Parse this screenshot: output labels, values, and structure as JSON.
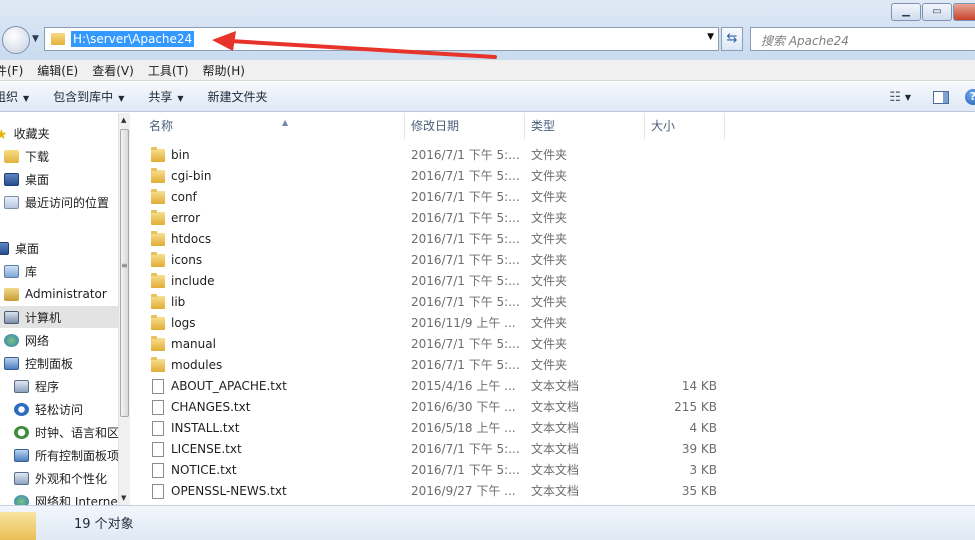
{
  "address": {
    "path": "H:\\server\\Apache24"
  },
  "search": {
    "placeholder": "搜索 Apache24"
  },
  "window_controls": {
    "minimize": "▁",
    "maximize": "▭",
    "close": ""
  },
  "menu": [
    "件(F)",
    "编辑(E)",
    "查看(V)",
    "工具(T)",
    "帮助(H)"
  ],
  "toolbar": {
    "organize": "组织",
    "include_in_library": "包含到库中",
    "share": "共享",
    "new_folder": "新建文件夹"
  },
  "nav": [
    {
      "label": "收藏夹",
      "icon": "star-icon"
    },
    {
      "label": "下载",
      "icon": "download-folder-icon"
    },
    {
      "label": "桌面",
      "icon": "desktop-icon"
    },
    {
      "label": "最近访问的位置",
      "icon": "recent-places-icon"
    },
    {
      "label": "桌面",
      "icon": "desktop-icon"
    },
    {
      "label": "库",
      "icon": "library-icon"
    },
    {
      "label": "Administrator",
      "icon": "user-folder-icon"
    },
    {
      "label": "计算机",
      "icon": "computer-icon",
      "selected": true
    },
    {
      "label": "网络",
      "icon": "network-icon"
    },
    {
      "label": "控制面板",
      "icon": "control-panel-icon"
    },
    {
      "label": "程序",
      "icon": "programs-icon"
    },
    {
      "label": "轻松访问",
      "icon": "ease-of-access-icon"
    },
    {
      "label": "时钟、语言和区",
      "icon": "clock-icon"
    },
    {
      "label": "所有控制面板项",
      "icon": "all-control-panel-icon"
    },
    {
      "label": "外观和个性化",
      "icon": "appearance-icon"
    },
    {
      "label": "网络和 Interne",
      "icon": "network-internet-icon"
    }
  ],
  "columns": {
    "name": "名称",
    "date": "修改日期",
    "type": "类型",
    "size": "大小"
  },
  "files": [
    {
      "name": "bin",
      "date": "2016/7/1 下午 5:...",
      "type": "文件夹",
      "size": "",
      "kind": "folder"
    },
    {
      "name": "cgi-bin",
      "date": "2016/7/1 下午 5:...",
      "type": "文件夹",
      "size": "",
      "kind": "folder"
    },
    {
      "name": "conf",
      "date": "2016/7/1 下午 5:...",
      "type": "文件夹",
      "size": "",
      "kind": "folder"
    },
    {
      "name": "error",
      "date": "2016/7/1 下午 5:...",
      "type": "文件夹",
      "size": "",
      "kind": "folder"
    },
    {
      "name": "htdocs",
      "date": "2016/7/1 下午 5:...",
      "type": "文件夹",
      "size": "",
      "kind": "folder"
    },
    {
      "name": "icons",
      "date": "2016/7/1 下午 5:...",
      "type": "文件夹",
      "size": "",
      "kind": "folder"
    },
    {
      "name": "include",
      "date": "2016/7/1 下午 5:...",
      "type": "文件夹",
      "size": "",
      "kind": "folder"
    },
    {
      "name": "lib",
      "date": "2016/7/1 下午 5:...",
      "type": "文件夹",
      "size": "",
      "kind": "folder"
    },
    {
      "name": "logs",
      "date": "2016/11/9 上午 ...",
      "type": "文件夹",
      "size": "",
      "kind": "folder"
    },
    {
      "name": "manual",
      "date": "2016/7/1 下午 5:...",
      "type": "文件夹",
      "size": "",
      "kind": "folder"
    },
    {
      "name": "modules",
      "date": "2016/7/1 下午 5:...",
      "type": "文件夹",
      "size": "",
      "kind": "folder"
    },
    {
      "name": "ABOUT_APACHE.txt",
      "date": "2015/4/16 上午 ...",
      "type": "文本文档",
      "size": "14 KB",
      "kind": "file"
    },
    {
      "name": "CHANGES.txt",
      "date": "2016/6/30 下午 ...",
      "type": "文本文档",
      "size": "215 KB",
      "kind": "file"
    },
    {
      "name": "INSTALL.txt",
      "date": "2016/5/18 上午 ...",
      "type": "文本文档",
      "size": "4 KB",
      "kind": "file"
    },
    {
      "name": "LICENSE.txt",
      "date": "2016/7/1 下午 5:...",
      "type": "文本文档",
      "size": "39 KB",
      "kind": "file"
    },
    {
      "name": "NOTICE.txt",
      "date": "2016/7/1 下午 5:...",
      "type": "文本文档",
      "size": "3 KB",
      "kind": "file"
    },
    {
      "name": "OPENSSL-NEWS.txt",
      "date": "2016/9/27 下午 ...",
      "type": "文本文档",
      "size": "35 KB",
      "kind": "file"
    }
  ],
  "status": {
    "count": "19 个对象"
  },
  "colors": {
    "selection": "#3399ff",
    "annotation_arrow": "#e8332a"
  }
}
